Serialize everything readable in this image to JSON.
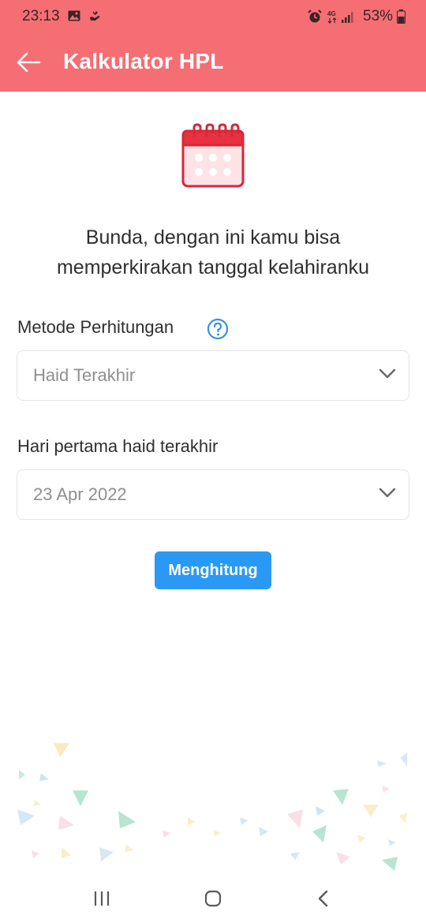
{
  "status_bar": {
    "time": "23:13",
    "battery": "53%",
    "network": "4G",
    "icons": [
      "gallery-icon",
      "hand-icon",
      "alarm-icon",
      "signal-icon",
      "battery-icon"
    ]
  },
  "app_bar": {
    "title": "Kalkulator HPL",
    "back_icon": "arrow-left-icon",
    "background_color": "#f56e74"
  },
  "hero": {
    "icon": "calendar-icon",
    "headline_line1": "Bunda, dengan ini kamu bisa",
    "headline_line2": "memperkirakan tanggal kelahiranku"
  },
  "form": {
    "method_label": "Metode Perhitungan",
    "method_help_icon": "question-circle-icon",
    "method_value": "Haid Terakhir",
    "date_label": "Hari pertama haid terakhir",
    "date_value": "23 Apr 2022",
    "submit_label": "Menghitung",
    "accent_color": "#2a99f5"
  },
  "nav_bar": {
    "icons": [
      "recent-apps-icon",
      "home-icon",
      "back-icon"
    ]
  }
}
